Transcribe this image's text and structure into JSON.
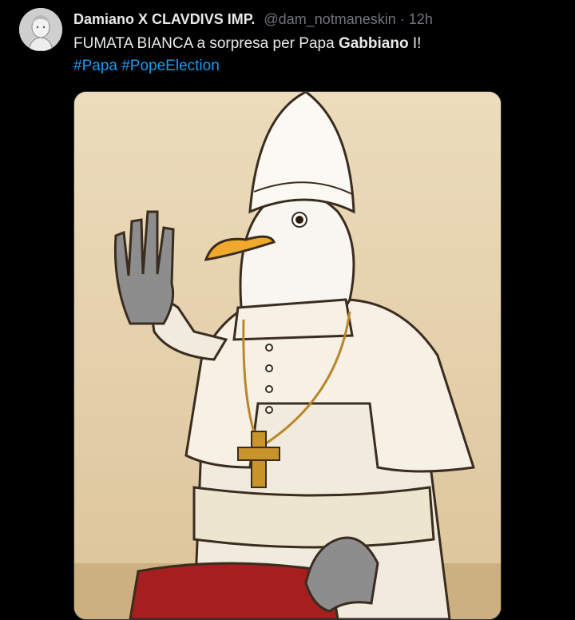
{
  "tweet": {
    "display_name": "Damiano X CLAVDIVS IMP.",
    "handle": "@dam_notmaneskin",
    "separator": "·",
    "time": "12h",
    "text_before": "FUMATA BIANCA a sorpresa per Papa ",
    "text_bold": "Gabbiano",
    "text_after": " I!",
    "hashtags": [
      "#Papa",
      "#PopeElection"
    ]
  },
  "avatar": {
    "icon": "roman-emperor-bust-avatar"
  },
  "media": {
    "icon": "seagull-pope-illustration"
  },
  "colors": {
    "background": "#000000",
    "text": "#e7e9ea",
    "muted": "#71767b",
    "link": "#1d9bf0",
    "image_bg": "#e6d2ad"
  }
}
